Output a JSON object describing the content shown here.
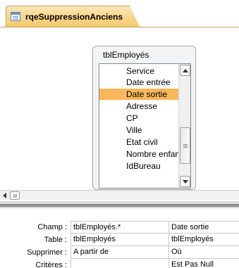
{
  "tab": {
    "title": "rqeSuppressionAnciens",
    "icon": "query-icon"
  },
  "field_list": {
    "title": "tblEmployés",
    "items": [
      {
        "label": "Service",
        "selected": false
      },
      {
        "label": "Date entrée",
        "selected": false
      },
      {
        "label": "Date sortie",
        "selected": true
      },
      {
        "label": "Adresse",
        "selected": false
      },
      {
        "label": "CP",
        "selected": false
      },
      {
        "label": "Ville",
        "selected": false
      },
      {
        "label": "Etat civil",
        "selected": false
      },
      {
        "label": "Nombre enfants",
        "selected": false
      },
      {
        "label": "IdBureau",
        "selected": false
      }
    ],
    "selected_color": "#f7b75a"
  },
  "grid": {
    "rows": [
      {
        "label": "Champ :",
        "col1": "tblEmployés.*",
        "col2": "Date sortie"
      },
      {
        "label": "Table :",
        "col1": "tblEmployés",
        "col2": "tblEmployés"
      },
      {
        "label": "Supprimer :",
        "col1": "A partir de",
        "col2": "Où"
      },
      {
        "label": "Critères :",
        "col1": "",
        "col2": "Est Pas Null"
      }
    ]
  }
}
